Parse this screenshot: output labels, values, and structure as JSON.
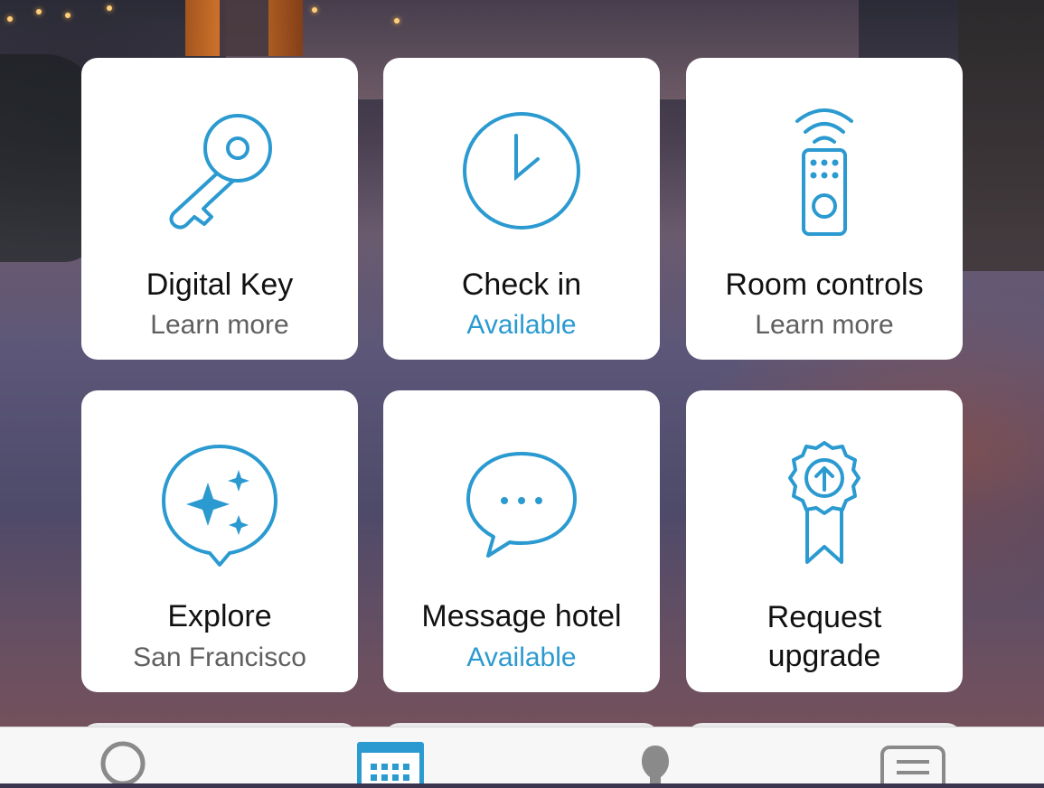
{
  "tiles": [
    {
      "title": "Digital Key",
      "subtitle": "Learn more",
      "icon": "key-icon",
      "subtitle_style": "muted"
    },
    {
      "title": "Check in",
      "subtitle": "Available",
      "icon": "clock-icon",
      "subtitle_style": "accent"
    },
    {
      "title": "Room controls",
      "subtitle": "Learn more",
      "icon": "remote-control-icon",
      "subtitle_style": "muted"
    },
    {
      "title": "Explore",
      "subtitle": "San Francisco",
      "icon": "sparkle-pin-icon",
      "subtitle_style": "muted"
    },
    {
      "title": "Message hotel",
      "subtitle": "Available",
      "icon": "chat-bubble-icon",
      "subtitle_style": "accent"
    },
    {
      "title_line1": "Request",
      "title_line2": "upgrade",
      "icon": "award-ribbon-upgrade-icon"
    }
  ],
  "tabbar": {
    "items": [
      {
        "icon": "search-icon"
      },
      {
        "icon": "calendar-icon",
        "active": true
      },
      {
        "icon": "profile-icon"
      },
      {
        "icon": "list-icon"
      }
    ]
  },
  "colors": {
    "accent": "#2b9ad0",
    "icon_stroke": "#2b9ad0",
    "tile_bg": "#ffffff",
    "muted_text": "#5f5f5f"
  }
}
